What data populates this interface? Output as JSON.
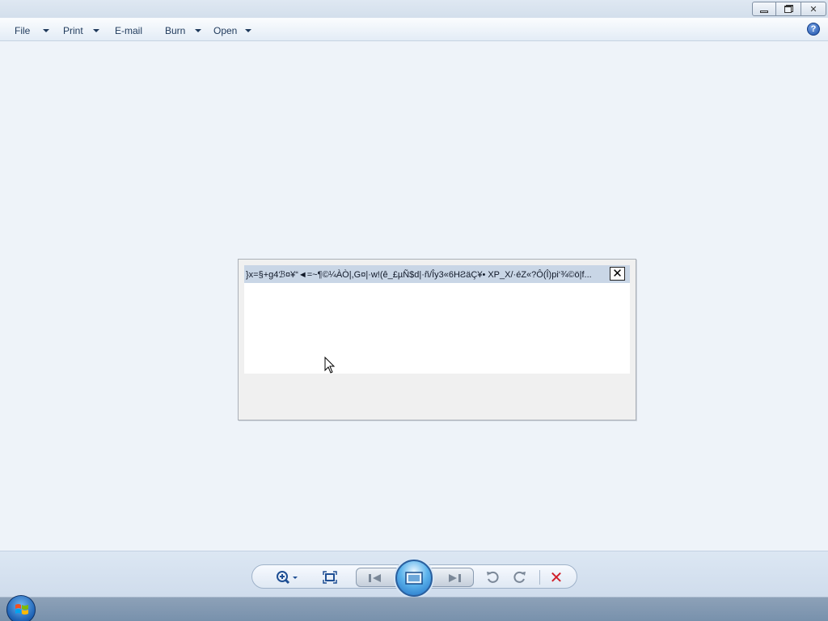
{
  "menubar": {
    "items": [
      {
        "label": "File",
        "has_dropdown": true
      },
      {
        "label": "Print",
        "has_dropdown": true
      },
      {
        "label": "E-mail",
        "has_dropdown": false
      },
      {
        "label": "Burn",
        "has_dropdown": true
      },
      {
        "label": "Open",
        "has_dropdown": true
      }
    ],
    "help_icon": "help-icon"
  },
  "window_controls": {
    "minimize_icon": "minimize-icon",
    "restore_icon": "restore-icon",
    "close_glyph": "✕"
  },
  "dialog": {
    "title": "}x=§+g4ℬ¤¥“◄=~¶©¼ÀÒ|,G¤|·w!(ê_£µÑ$d|·ñ/Îy3«6HƧäÇ¥•    XP_X/·éZ«?Ô(Î)pi‘¾©ö|f...",
    "close_glyph": "✕"
  },
  "controls": {
    "zoom_icon": "zoom-icon",
    "fit_icon": "actual-size-icon",
    "previous_icon": "previous-icon",
    "slideshow_icon": "slideshow-icon",
    "next_icon": "next-icon",
    "rotate_ccw_icon": "rotate-counterclockwise-icon",
    "rotate_cw_icon": "rotate-clockwise-icon",
    "delete_glyph": "✕"
  },
  "colors": {
    "canvas_bg": "#eef3f9",
    "dialog_title_bg": "#c9d6e6",
    "accent_blue": "#2b5a9b",
    "delete_red": "#d0202a"
  }
}
